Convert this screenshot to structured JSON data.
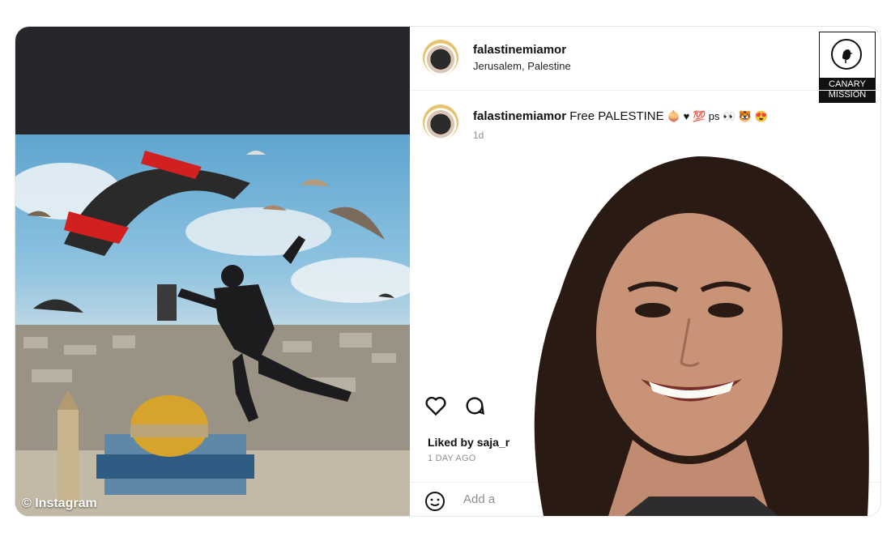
{
  "post": {
    "username": "falastinemiamor",
    "location": "Jerusalem, Palestine",
    "caption_user": "falastinemiamor",
    "caption_text": "Free PALESTINE",
    "caption_emojis": "🧅 ♥ 💯 ps 👀 🐯 😍",
    "time": "1d",
    "liked_prefix": "Liked by",
    "liked_user": "saja_r",
    "day_ago": "1 DAY AGO",
    "comment_placeholder": "Add a"
  },
  "watermark": "© Instagram",
  "badge": {
    "line1": "CANARY",
    "line2": "MISSION"
  },
  "icons": [
    "heart-icon",
    "comment-icon",
    "bookmark-icon",
    "emoji-icon",
    "bird-icon"
  ]
}
